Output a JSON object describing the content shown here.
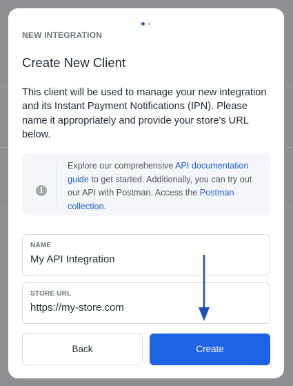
{
  "modal": {
    "eyebrow": "NEW INTEGRATION",
    "title": "Create New Client",
    "description": "This client will be used to manage your new integration and its Instant Payment Notifications (IPN). Please name it appropriately and provide your store's URL below.",
    "step_indicator": {
      "total": 2,
      "active": 1
    }
  },
  "info": {
    "icon": "info-icon",
    "text_before_link1": "Explore our comprehensive ",
    "link1": "API documentation guide",
    "text_after_link1": " to get started. Additionally, you can try out our API with Postman. Access the ",
    "link2": "Postman collection",
    "text_after_link2": "."
  },
  "form": {
    "name_label": "NAME",
    "name_value": "My API Integration",
    "url_label": "STORE URL",
    "url_value": "https://my-store.com"
  },
  "buttons": {
    "back": "Back",
    "create": "Create"
  },
  "colors": {
    "accent": "#1e62e6",
    "link": "#1d5fd6",
    "overlay": "#8e8f93",
    "annotation_arrow": "#1b4fb8"
  }
}
